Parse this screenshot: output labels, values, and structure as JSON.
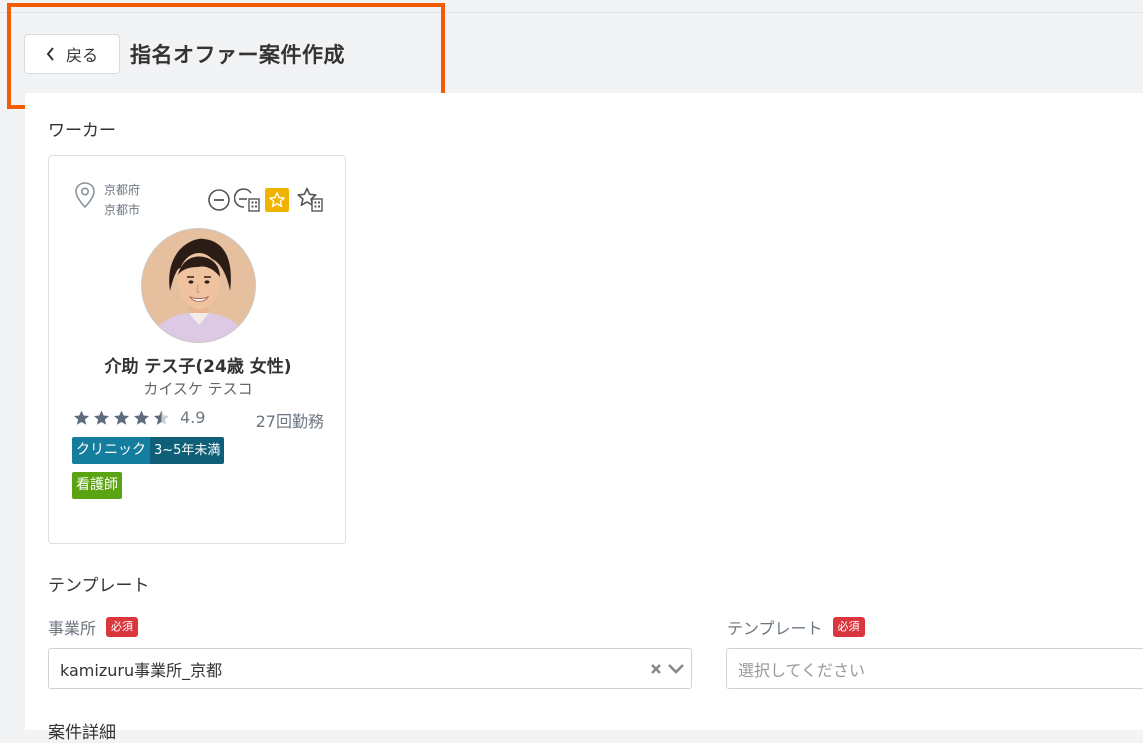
{
  "header": {
    "back_label": "戻る",
    "title": "指名オファー案件作成"
  },
  "worker_section": {
    "title": "ワーカー"
  },
  "worker": {
    "prefecture": "京都府",
    "city": "京都市",
    "name": "介助 テス子(24歳 女性)",
    "kana": "カイスケ テスコ",
    "rating": "4.9",
    "rating_stars": 4.5,
    "work_count": "27回勤務",
    "tag_workplace": "クリニック",
    "tag_experience": "3~5年未満",
    "tag_license": "看護師",
    "status_icons": [
      "minus-circle-icon",
      "block-facility-icon",
      "favorite-star-icon",
      "favorite-facility-icon"
    ]
  },
  "template_section": {
    "title": "テンプレート",
    "office_label": "事業所",
    "office_value": "kamizuru事業所_京都",
    "template_label": "テンプレート",
    "template_placeholder": "選択してください",
    "required": "必須"
  },
  "next_section": {
    "title": "案件詳細"
  },
  "colors": {
    "highlight": "#f25c05",
    "required": "#d9363e",
    "favorite": "#f0b400",
    "tag_blue": "#157d9e",
    "tag_green": "#5aa312"
  }
}
